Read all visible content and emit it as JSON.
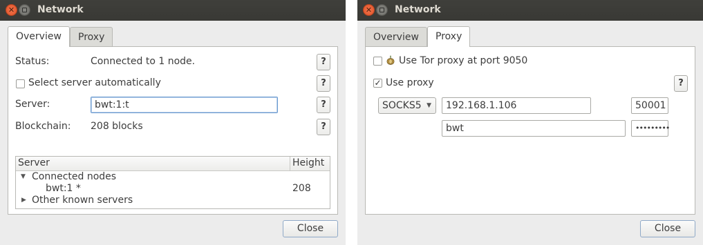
{
  "left": {
    "window_title": "Network",
    "tabs": [
      {
        "label": "Overview"
      },
      {
        "label": "Proxy"
      }
    ],
    "status_label": "Status:",
    "status_value": "Connected to 1 node.",
    "auto_server_label": "Select server automatically",
    "server_label": "Server:",
    "server_value": "bwt:1:t",
    "blockchain_label": "Blockchain:",
    "blockchain_value": "208 blocks",
    "help_label": "?",
    "tree": {
      "columns": [
        "Server",
        "Height"
      ],
      "rows": [
        {
          "label": "Connected nodes",
          "height": "",
          "expanded": true
        },
        {
          "label": "bwt:1 *",
          "height": "208"
        },
        {
          "label": "Other known servers",
          "height": "",
          "expanded": false
        }
      ]
    },
    "close_label": "Close"
  },
  "right": {
    "window_title": "Network",
    "tabs": [
      {
        "label": "Overview"
      },
      {
        "label": "Proxy"
      }
    ],
    "tor_label": "Use Tor proxy at port 9050",
    "tor_checked": false,
    "use_proxy_label": "Use proxy",
    "use_proxy_checked": true,
    "proxy_type": "SOCKS5",
    "proxy_host": "192.168.1.106",
    "proxy_port": "50001",
    "proxy_user": "bwt",
    "proxy_password": "•••••••••",
    "help_label": "?",
    "close_label": "Close"
  },
  "colors": {
    "titlebar": "#3c3c38",
    "close_accent": "#e95420",
    "focus": "#6b9bd1"
  }
}
